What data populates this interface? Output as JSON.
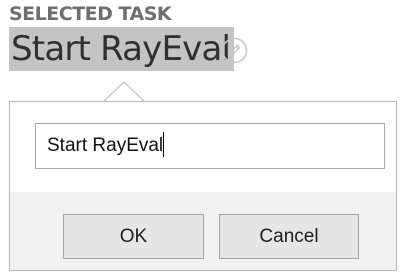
{
  "header": {
    "section_label": "SELECTED TASK",
    "task_name": "Start RayEval"
  },
  "icons": {
    "edit": "edit-pencil-icon"
  },
  "edit_popup": {
    "input_value": "Start RayEval",
    "ok_label": "OK",
    "cancel_label": "Cancel"
  },
  "colors": {
    "title_highlight": "#c4c4c4",
    "label_text": "#6e6e6e",
    "popup_footer": "#f2f2f2",
    "button_face": "#e6e6e6"
  }
}
